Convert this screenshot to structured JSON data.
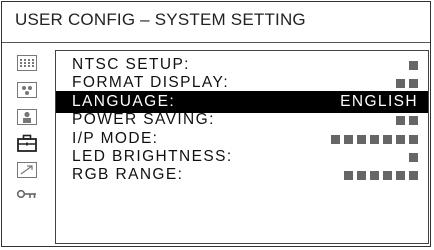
{
  "header": {
    "title": "USER CONFIG – SYSTEM SETTING"
  },
  "sidebar": {
    "icons": [
      {
        "name": "keypad-icon"
      },
      {
        "name": "camera-icon"
      },
      {
        "name": "person-icon"
      },
      {
        "name": "toolbox-icon",
        "selected": true
      },
      {
        "name": "arrow-icon"
      },
      {
        "name": "key-icon"
      }
    ]
  },
  "menu": {
    "items": [
      {
        "label": "NTSC SETUP:",
        "value": "",
        "blocks": 1
      },
      {
        "label": "FORMAT DISPLAY:",
        "value": "",
        "blocks": 2
      },
      {
        "label": "LANGUAGE:",
        "value": "ENGLISH",
        "blocks": 0,
        "selected": true
      },
      {
        "label": "POWER SAVING:",
        "value": "",
        "blocks": 2
      },
      {
        "label": "I/P MODE:",
        "value": "",
        "blocks": 7
      },
      {
        "label": "LED BRIGHTNESS:",
        "value": "",
        "blocks": 1
      },
      {
        "label": "RGB RANGE:",
        "value": "",
        "blocks": 6
      }
    ]
  },
  "colors": {
    "highlight_bg": "#000000",
    "highlight_text": "#ffffff",
    "placeholder_block": "#666666"
  }
}
